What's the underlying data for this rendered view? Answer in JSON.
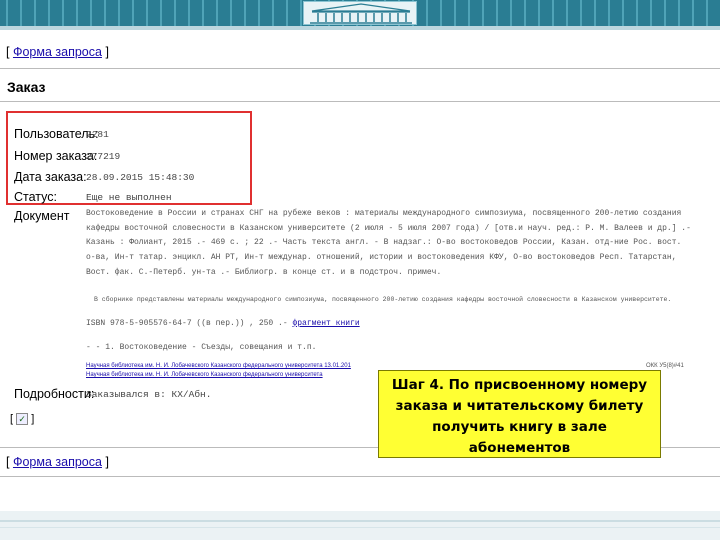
{
  "nav": {
    "open": "[",
    "link": "Форма запроса",
    "close": "]"
  },
  "title": "Заказ",
  "fields": [
    {
      "label": "Пользователь:",
      "value": "2281"
    },
    {
      "label": "Номер заказа:",
      "value": "277219"
    },
    {
      "label": "Дата заказа:",
      "value": "28.09.2015 15:48:30"
    },
    {
      "label": "Статус:",
      "value": "Еще не выполнен"
    }
  ],
  "document": {
    "label": "Документ",
    "lines": [
      "Востоковедение в России и странах СНГ на рубеже веков : материалы международного симпозиума, посвященного 200-летию создания",
      "кафедры восточной словесности в Казанском университете (2 июля - 5 июля 2007 года) / [отв.и науч. ред.: Р. М. Валеев и др.] .-",
      "Казань : Фолиант, 2015 .- 469 с. ; 22 .- Часть текста англ. - В надзаг.: О-во востоковедов России, Казан. отд-ние Рос. вост.",
      "о-ва, Ин-т татар. энцикл. АН РТ, Ин-т междунар. отношений, истории и востоковедения КФУ, О-во востоковедов Респ. Татарстан,",
      "Вост. фак. С.-Петерб. ун-та .- Библиогр. в конце ст. и в подстроч. примеч."
    ],
    "note": "В сборнике представлены материалы международного симпозиума, посвященного 200-летию создания кафедры восточной словесности в Казанском университете.",
    "isbn": "ISBN 978-5-905576-64-7 ((в пер.)) , 250 .-",
    "isbn_link": "фрагмент книги",
    "subject": "- - 1. Востоковедение - Съезды, совещания и т.п."
  },
  "libraries": [
    {
      "name": "Научная библиотека им. Н. И. Лобачевского Казанского федерального университета 13.01.201",
      "right": "ОКК У5(8)#41"
    },
    {
      "name": "Научная библиотека им. Н. И. Лобачевского Казанского федерального университета",
      "right": ""
    }
  ],
  "details": {
    "label": "Подробности:",
    "value": "Заказывался в: КХ/Абн."
  },
  "checkbox": {
    "open": "[",
    "mark": "✓",
    "close": "]"
  },
  "callout": {
    "lines": [
      "Шаг 4. По присвоенному номеру",
      "заказа и читательскому билету",
      "получить книгу в зале",
      "абонементов"
    ]
  },
  "colors": {
    "header": "#2a7d93",
    "highlight": "#e03030",
    "callout": "#ffff33",
    "link": "#1a0dab"
  }
}
